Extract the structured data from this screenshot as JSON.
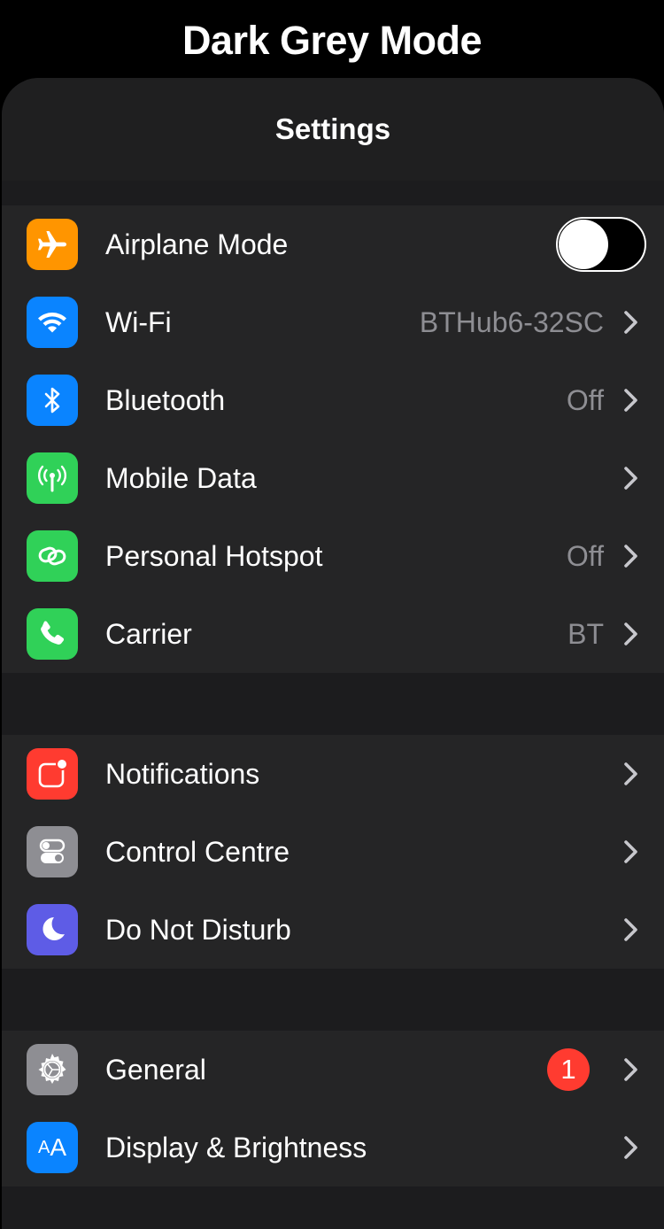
{
  "header": {
    "title": "Dark Grey Mode"
  },
  "navbar": {
    "title": "Settings"
  },
  "groups": [
    {
      "rows": [
        {
          "label": "Airplane Mode",
          "icon": "airplane-icon",
          "icon_color": "#ff9500",
          "toggle": false
        },
        {
          "label": "Wi-Fi",
          "value": "BTHub6-32SC",
          "icon": "wifi-icon",
          "icon_color": "#0a84ff"
        },
        {
          "label": "Bluetooth",
          "value": "Off",
          "icon": "bluetooth-icon",
          "icon_color": "#0a84ff"
        },
        {
          "label": "Mobile Data",
          "value": "",
          "icon": "antenna-icon",
          "icon_color": "#30d158"
        },
        {
          "label": "Personal Hotspot",
          "value": "Off",
          "icon": "hotspot-chain-icon",
          "icon_color": "#30d158"
        },
        {
          "label": "Carrier",
          "value": "BT",
          "icon": "phone-icon",
          "icon_color": "#30d158"
        }
      ]
    },
    {
      "rows": [
        {
          "label": "Notifications",
          "icon": "notifications-icon",
          "icon_color": "#ff3b30"
        },
        {
          "label": "Control Centre",
          "icon": "switches-icon",
          "icon_color": "#8e8e93"
        },
        {
          "label": "Do Not Disturb",
          "icon": "moon-icon",
          "icon_color": "#5e5ce6"
        }
      ]
    },
    {
      "rows": [
        {
          "label": "General",
          "badge": "1",
          "icon": "gear-icon",
          "icon_color": "#8e8e93"
        },
        {
          "label": "Display & Brightness",
          "icon": "text-size-icon",
          "icon_color": "#0a84ff",
          "icon_text": "AA"
        }
      ]
    }
  ]
}
